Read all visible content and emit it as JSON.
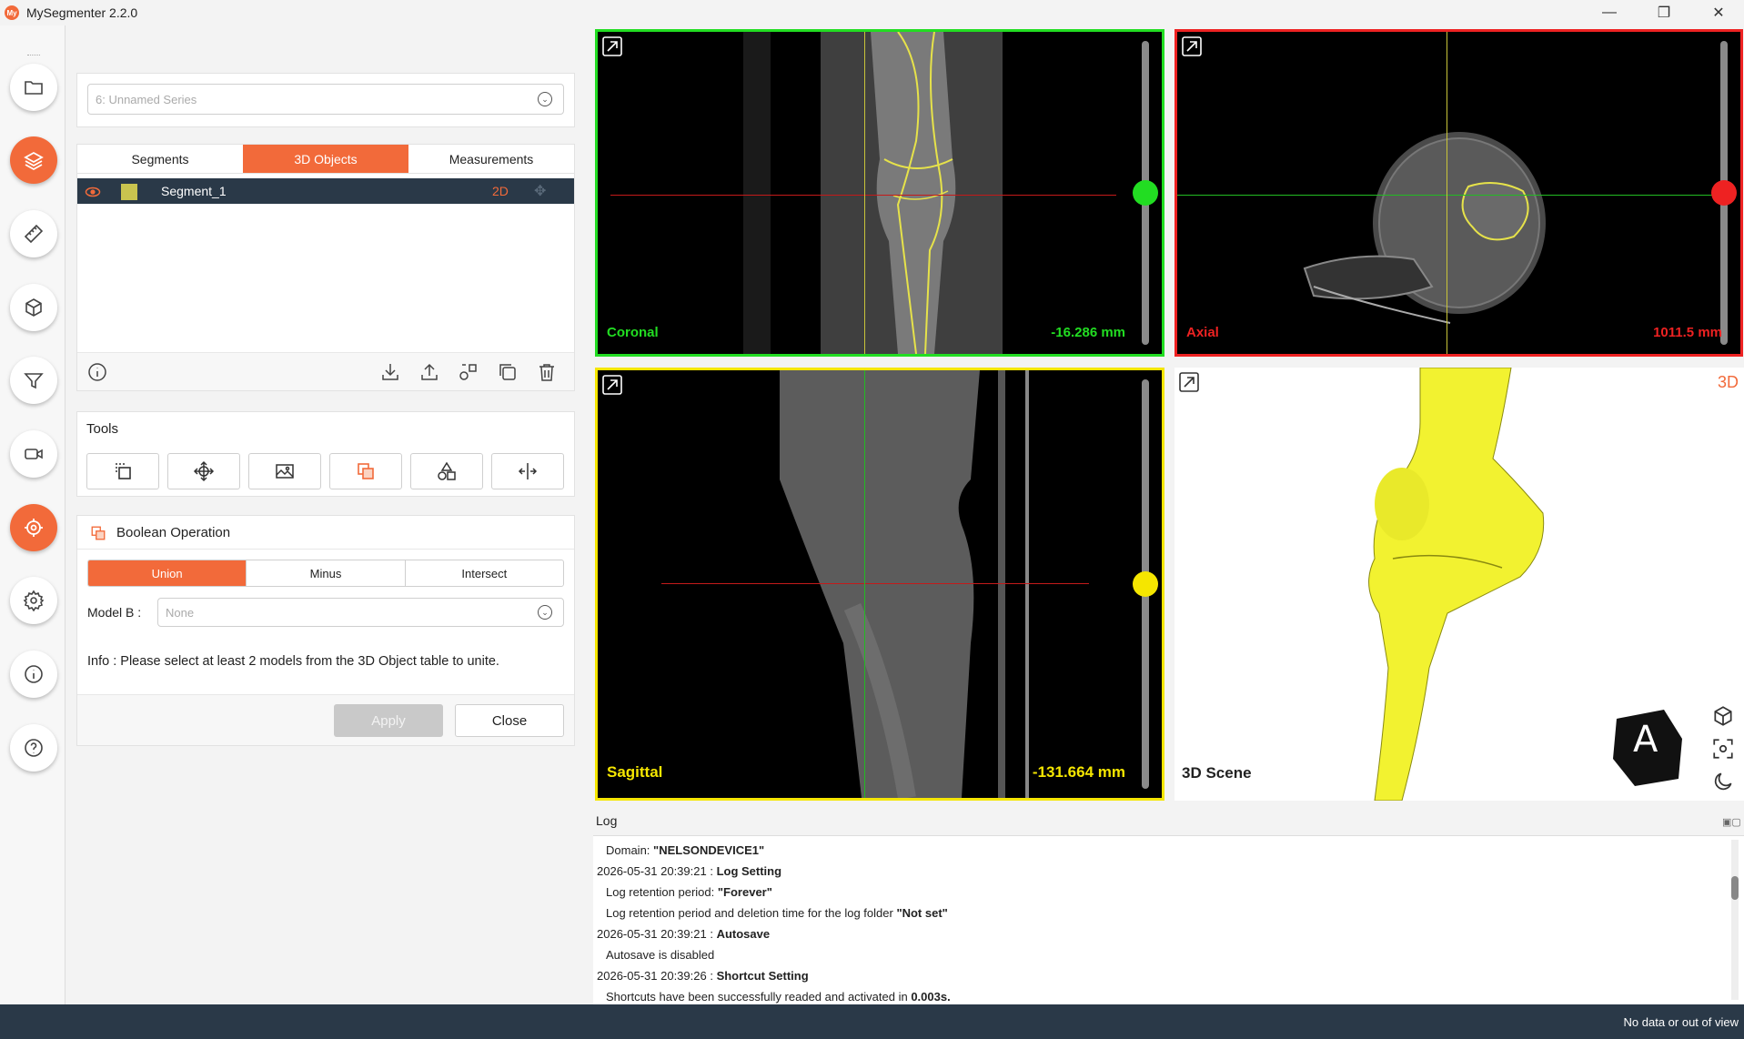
{
  "app": {
    "title": "MySegmenter 2.2.0",
    "logo_text": "My"
  },
  "series_select": {
    "value": "6: Unnamed Series"
  },
  "tabs": [
    {
      "label": "Segments",
      "active": false
    },
    {
      "label": "3D Objects",
      "active": true
    },
    {
      "label": "Measurements",
      "active": false
    }
  ],
  "segments": [
    {
      "name": "Segment_1",
      "mode": "2D",
      "color": "#c9c44f"
    }
  ],
  "tools": {
    "title": "Tools"
  },
  "boolean": {
    "title": "Boolean Operation",
    "ops": [
      {
        "label": "Union",
        "active": true
      },
      {
        "label": "Minus",
        "active": false
      },
      {
        "label": "Intersect",
        "active": false
      }
    ],
    "model_b_label": "Model B :",
    "model_b_placeholder": "None",
    "info": "Info : Please select at least 2 models from the 3D Object table to unite.",
    "apply_label": "Apply",
    "close_label": "Close"
  },
  "views": {
    "coronal": {
      "label": "Coronal",
      "position": "-16.286 mm",
      "color": "#22dd22",
      "slice_level": 0.5
    },
    "axial": {
      "label": "Axial",
      "position": "1011.5 mm",
      "color": "#ee2222",
      "slice_level": 0.5
    },
    "sagittal": {
      "label": "Sagittal",
      "position": "-131.664 mm",
      "color": "#f5e600",
      "slice_level": 0.5
    },
    "scene3d": {
      "badge": "3D",
      "label": "3D Scene",
      "cube_letter": "A"
    }
  },
  "log": {
    "title": "Log",
    "lines": [
      {
        "plain": "Domain: ",
        "bold": "\"NELSONDEVICE1\"",
        "tail": "",
        "indent": true
      },
      {
        "plain": "2026-05-31 20:39:21 : ",
        "bold": "Log Setting",
        "tail": "",
        "indent": false
      },
      {
        "plain": "Log retention period: ",
        "bold": "\"Forever\"",
        "tail": "",
        "indent": true
      },
      {
        "plain": "Log retention period and deletion time for the log folder ",
        "bold": "\"Not set\"",
        "tail": "",
        "indent": true
      },
      {
        "plain": "2026-05-31 20:39:21 : ",
        "bold": "Autosave",
        "tail": "",
        "indent": false
      },
      {
        "plain": "Autosave is disabled",
        "bold": "",
        "tail": "",
        "indent": true
      },
      {
        "plain": "2026-05-31 20:39:26 : ",
        "bold": "Shortcut Setting",
        "tail": "",
        "indent": false
      },
      {
        "plain": "Shortcuts have been successfully readed and activated in ",
        "bold": "0.003s.",
        "tail": "",
        "indent": true
      }
    ]
  },
  "status": {
    "text": "No data or out of view"
  },
  "accent": "#f26a3a"
}
